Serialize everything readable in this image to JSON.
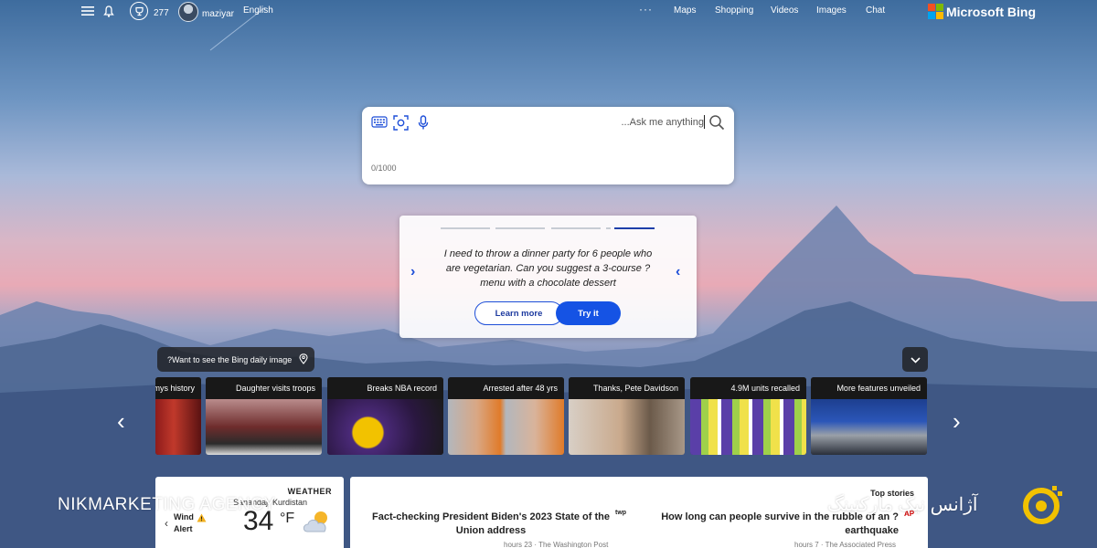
{
  "header": {
    "points": "277",
    "username": "maziyar",
    "language": "English",
    "more": "···",
    "nav": [
      "Maps",
      "Shopping",
      "Videos",
      "Images",
      "Chat"
    ],
    "brand": "Microsoft Bing"
  },
  "search": {
    "placeholder": "...Ask me anything",
    "counter": "0/1000"
  },
  "suggestion": {
    "text": "I need to throw a dinner party for 6 people who are vegetarian. Can you suggest a 3-course ?menu with a chocolate dessert",
    "learn_more": "Learn more",
    "try_it": "Try it"
  },
  "daily_image_prompt": "?Want to see the Bing daily image",
  "news_tiles": [
    {
      "caption": "mys history"
    },
    {
      "caption": "Daughter visits troops"
    },
    {
      "caption": "Breaks NBA record"
    },
    {
      "caption": "Arrested after 48 yrs"
    },
    {
      "caption": "Thanks, Pete Davidson"
    },
    {
      "caption": "4.9M units recalled"
    },
    {
      "caption": "More features unveiled"
    }
  ],
  "weather": {
    "label": "WEATHER",
    "location": "Sanandaj, Kurdistan",
    "alert": "Wind Alert",
    "temp": "34",
    "unit": "°F"
  },
  "stories": {
    "label": "Top stories",
    "items": [
      {
        "headline": "Fact-checking President Biden's 2023 State of the Union address",
        "meta": "hours 23 · The Washington Post",
        "source_badge": "twp"
      },
      {
        "headline": "How long can people survive in the rubble of an ?earthquake",
        "meta": "hours 7 · The Associated Press",
        "source_badge": "AP"
      }
    ]
  },
  "watermark": {
    "left": "NIKMARKETING AGENCY",
    "right": "آژانس نیک مارکتینگ"
  }
}
